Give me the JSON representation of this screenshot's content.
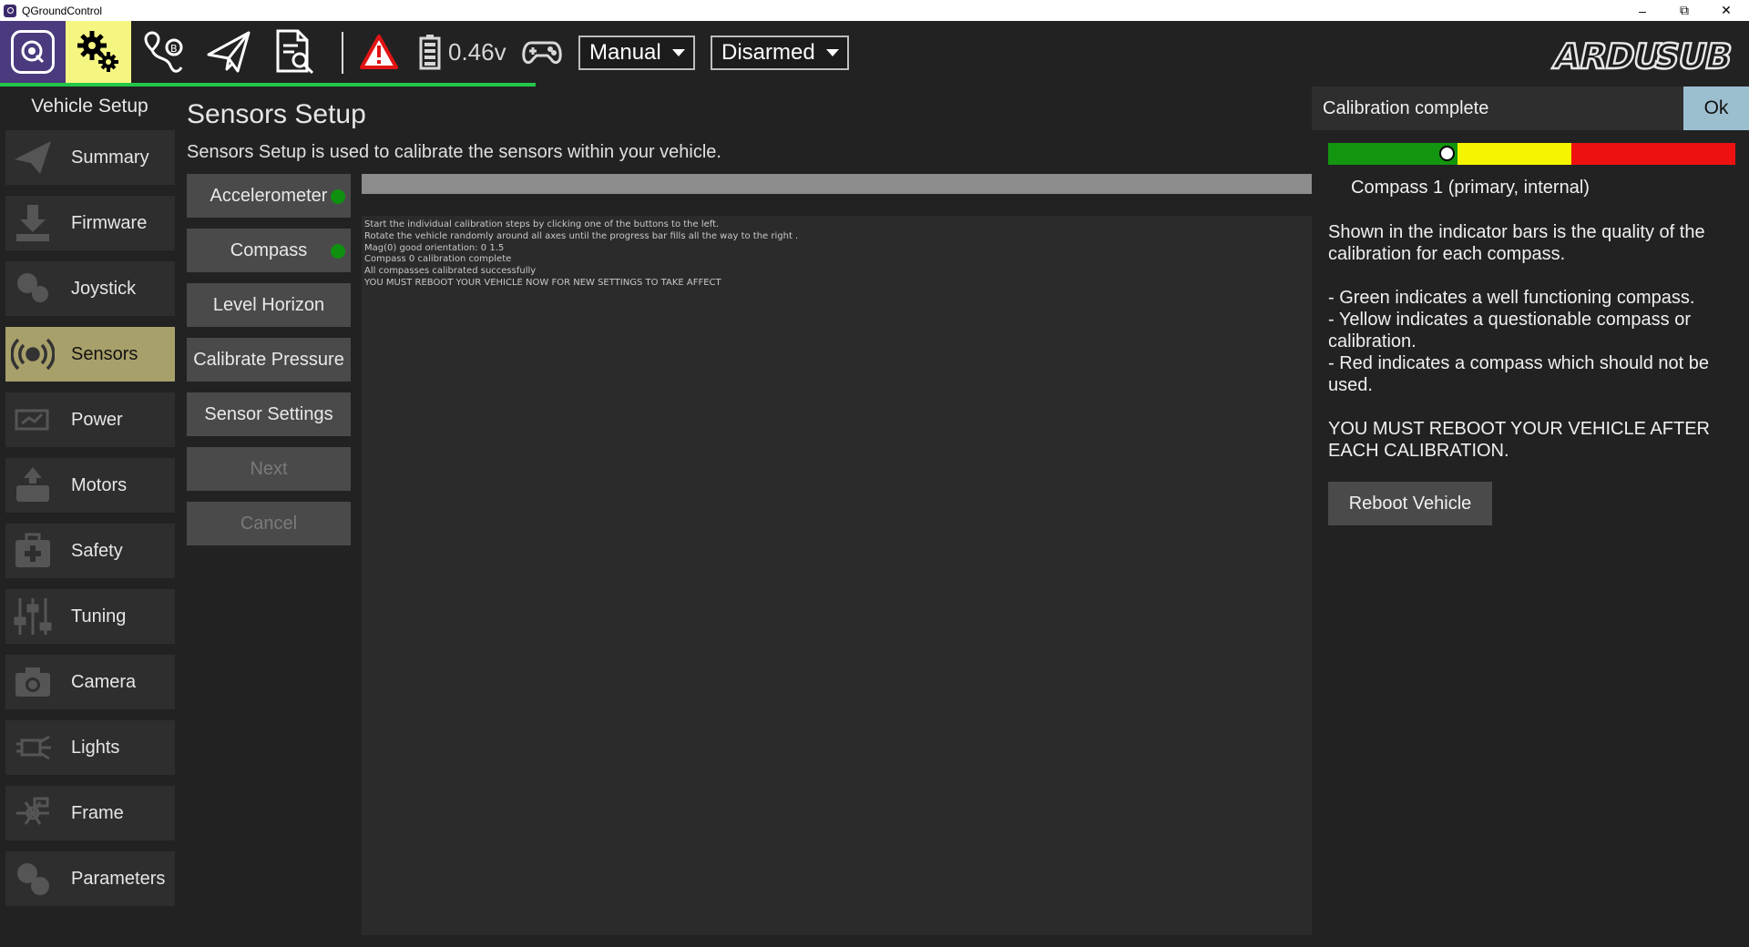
{
  "window": {
    "title": "QGroundControl"
  },
  "toolbar": {
    "battery_voltage": "0.46v",
    "flight_mode": "Manual",
    "arm_state": "Disarmed",
    "brand": "ARDUSUB",
    "colors": {
      "setup_active": "#f5f582",
      "progress": "#22c84a",
      "warning": "#e11414"
    }
  },
  "nav": {
    "header": "Vehicle Setup",
    "items": [
      {
        "label": "Summary",
        "icon": "paper-plane-icon"
      },
      {
        "label": "Firmware",
        "icon": "download-icon"
      },
      {
        "label": "Joystick",
        "icon": "gamepad-icon"
      },
      {
        "label": "Sensors",
        "icon": "sensor-signal-icon",
        "active": true
      },
      {
        "label": "Power",
        "icon": "power-icon"
      },
      {
        "label": "Motors",
        "icon": "motor-icon"
      },
      {
        "label": "Safety",
        "icon": "first-aid-icon"
      },
      {
        "label": "Tuning",
        "icon": "sliders-icon"
      },
      {
        "label": "Camera",
        "icon": "camera-icon"
      },
      {
        "label": "Lights",
        "icon": "light-icon"
      },
      {
        "label": "Frame",
        "icon": "frame-icon"
      },
      {
        "label": "Parameters",
        "icon": "gears-icon"
      }
    ]
  },
  "main": {
    "title": "Sensors Setup",
    "description": "Sensors Setup is used to calibrate the sensors within your vehicle.",
    "buttons": {
      "accelerometer": "Accelerometer",
      "compass": "Compass",
      "level_horizon": "Level Horizon",
      "calibrate_pressure": "Calibrate Pressure",
      "sensor_settings": "Sensor Settings",
      "next": "Next",
      "cancel": "Cancel"
    },
    "log": [
      "Start the individual calibration steps by clicking one of the buttons to the left.",
      "Rotate the vehicle randomly around all axes until the progress bar fills all the way to the right .",
      "Mag(0) good orientation: 0 1.5",
      "Compass 0 calibration complete",
      "All compasses calibrated successfully",
      "YOU MUST REBOOT YOUR VEHICLE NOW FOR NEW SETTINGS TO TAKE AFFECT"
    ]
  },
  "dialog": {
    "title": "Calibration complete",
    "ok": "Ok",
    "compass_label": "Compass 1 (primary, internal)",
    "quality_marker_fraction": 0.29,
    "bar_colors": [
      "#13950f",
      "#f5f500",
      "#ee1111"
    ],
    "info_paragraphs": [
      "Shown in the indicator bars is the quality of the calibration for each compass.",
      "",
      "- Green indicates a well functioning compass.",
      "- Yellow indicates a questionable compass or calibration.",
      "- Red indicates a compass which should not be used.",
      "",
      "YOU MUST REBOOT YOUR VEHICLE AFTER EACH CALIBRATION."
    ],
    "reboot": "Reboot Vehicle"
  }
}
